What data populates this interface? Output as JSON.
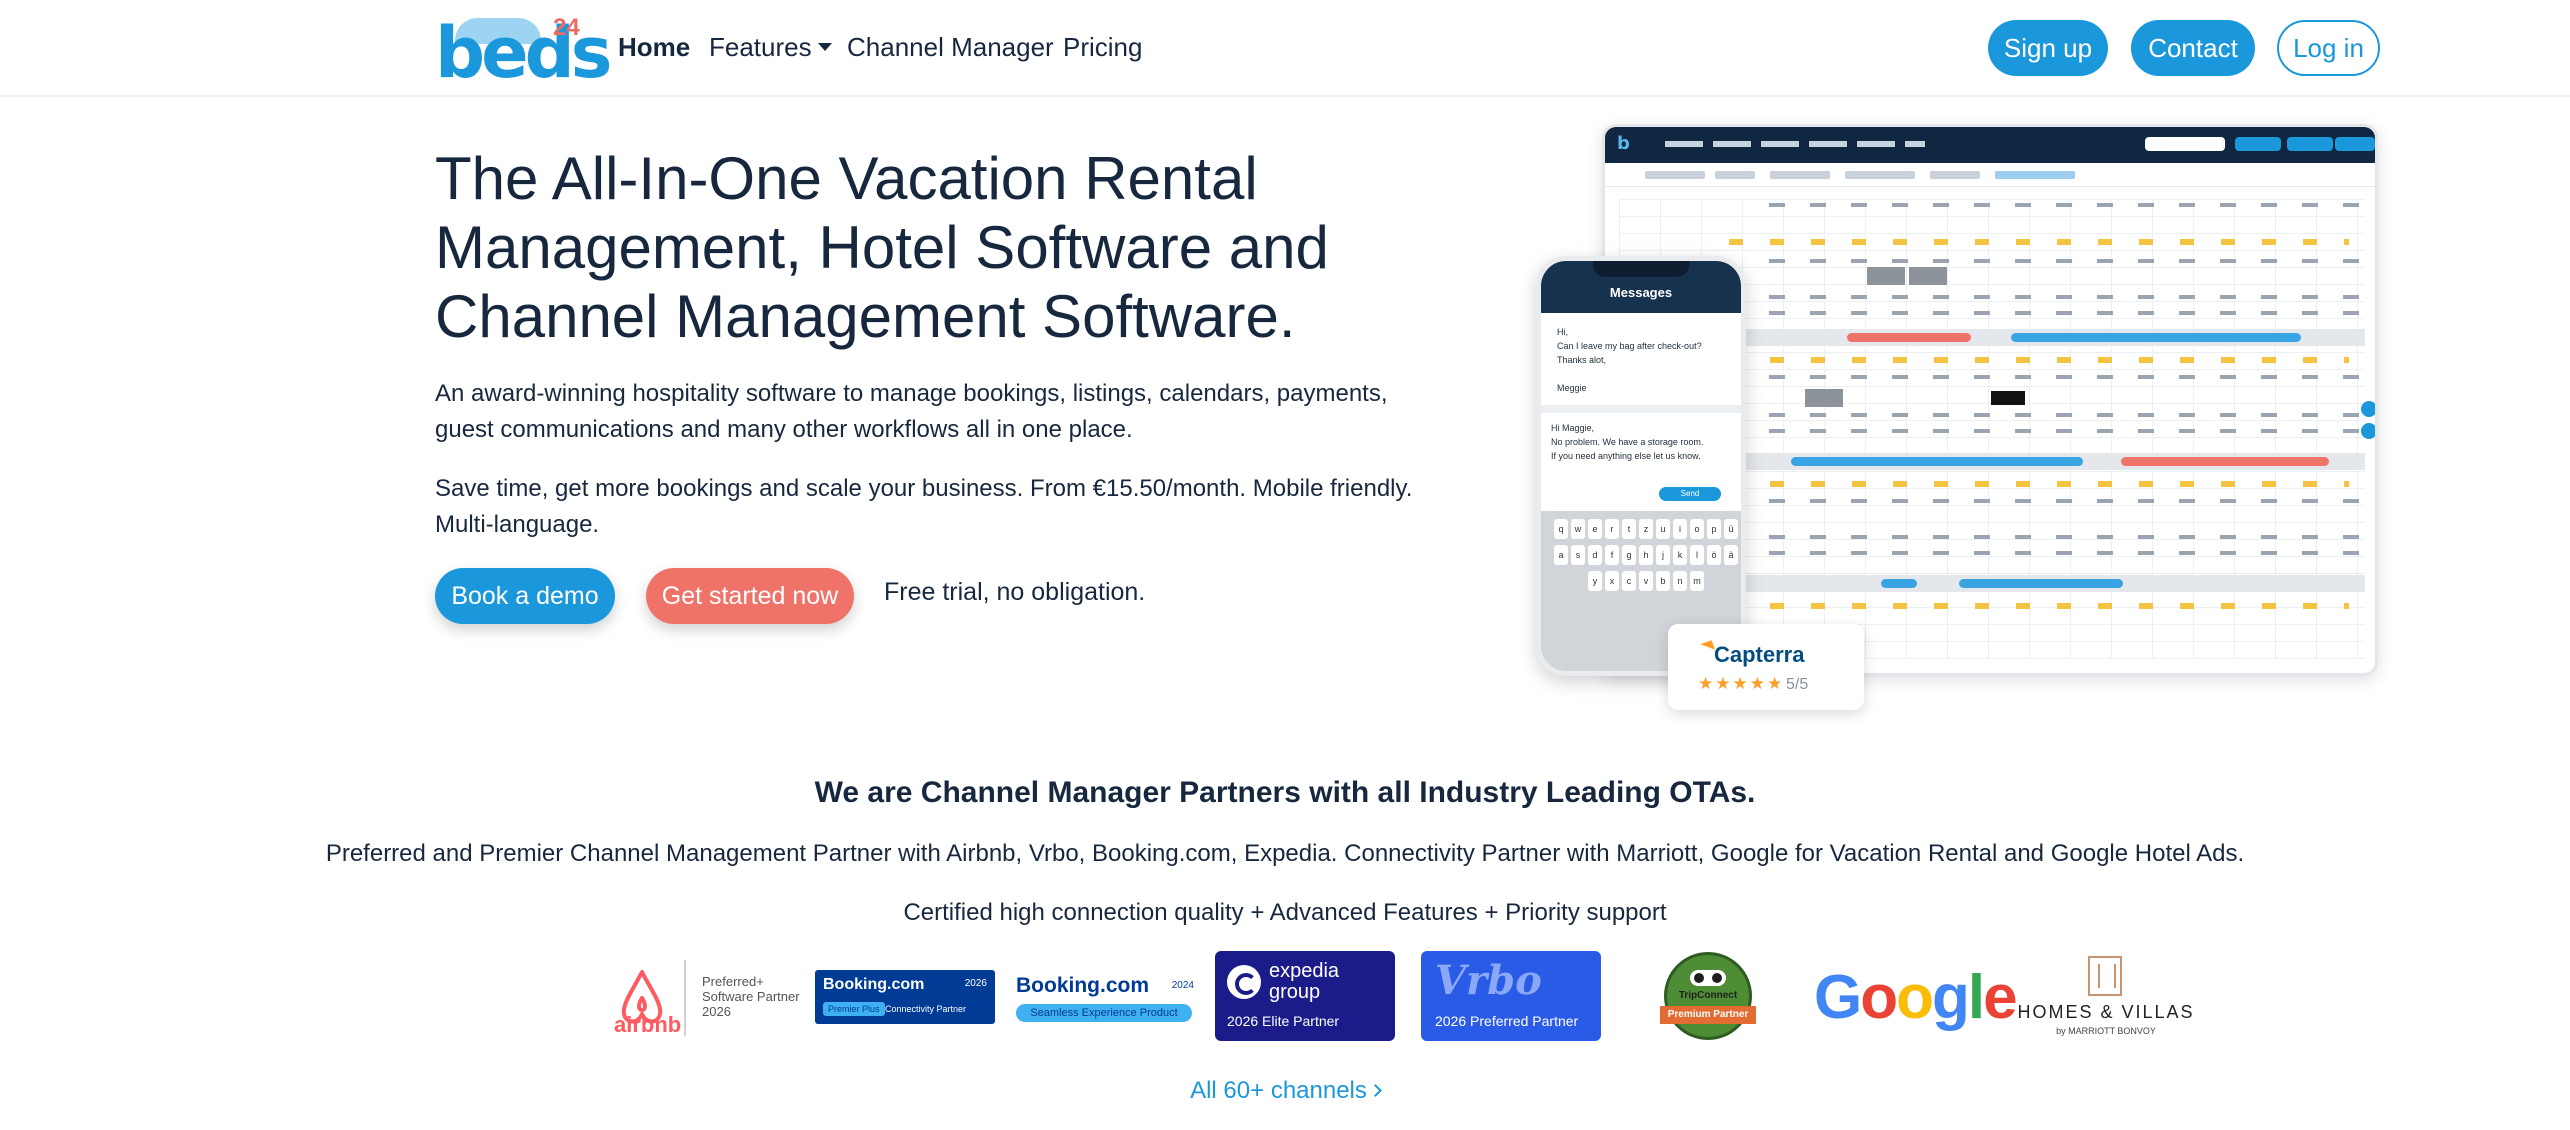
{
  "nav": {
    "logo": "beds",
    "logo_sup": "24",
    "links": [
      "Home",
      "Features",
      "Channel Manager",
      "Pricing"
    ],
    "signup": "Sign up",
    "contact": "Contact",
    "login": "Log in"
  },
  "hero": {
    "title": "The All-In-One Vacation Rental Management, Hotel Software and Channel Management Software.",
    "p1": "An award-winning hospitality software to manage bookings, listings, calendars, payments, guest communications and many other workflows all in one place.",
    "p2": "Save time, get more bookings and scale your business. From €15.50/month. Mobile friendly. Multi-language.",
    "demo_button": "Book a demo",
    "start_button": "Get started now",
    "free_text": "Free trial, no obligation."
  },
  "mockup": {
    "phone_title": "Messages",
    "msg_in": "Hi,\nCan I leave my bag after check-out?\nThanks alot,\n\nMeggie",
    "msg_out": "Hi Maggie,\nNo problem. We have a storage room.\nIf you need anything else let us know.",
    "send": "Send",
    "keyboard_rows": [
      [
        "q",
        "w",
        "e",
        "r",
        "t",
        "z",
        "u",
        "i",
        "o",
        "p",
        "ü"
      ],
      [
        "a",
        "s",
        "d",
        "f",
        "g",
        "h",
        "j",
        "k",
        "l",
        "ö",
        "ä"
      ],
      [
        "y",
        "x",
        "c",
        "v",
        "b",
        "n",
        "m"
      ]
    ],
    "capterra_name": "Capterra",
    "capterra_stars": "★★★★★",
    "capterra_score": "5/5"
  },
  "partners": {
    "heading": "We are Channel Manager Partners with all Industry Leading OTAs.",
    "sub1": "Preferred and Premier Channel Management Partner with Airbnb, Vrbo, Booking.com, Expedia. Connectivity Partner with Marriott, Google for Vacation Rental and Google Hotel Ads.",
    "sub2": "Certified high connection quality + Advanced Features + Priority support",
    "airbnb_word": "airbnb",
    "airbnb_text": "Preferred+\nSoftware Partner\n2026",
    "bk1_word": "Booking.com",
    "bk1_year": "2026",
    "bk1_pill": "Premier Plus",
    "bk1_text": "Connectivity Partner",
    "bk2_word": "Booking.com",
    "bk2_year": "2024",
    "bk2_pill": "Seamless Experience Product",
    "exp_word": "expedia\ngroup",
    "exp_badge": "2026 Elite Partner",
    "vrbo_word": "Vrbo",
    "vrbo_badge": "2026 Preferred Partner",
    "ta_word": "TripConnect",
    "ta_ribbon": "Premium Partner",
    "google_letters": [
      {
        "ch": "G",
        "color": "#4285F4"
      },
      {
        "ch": "o",
        "color": "#EA4335"
      },
      {
        "ch": "o",
        "color": "#FBBC05"
      },
      {
        "ch": "g",
        "color": "#4285F4"
      },
      {
        "ch": "l",
        "color": "#34A853"
      },
      {
        "ch": "e",
        "color": "#EA4335"
      }
    ],
    "hv_word": "HOMES & VILLAS",
    "hv_by": "by MARRIOTT BONVOY",
    "all_channels": "All 60+ channels"
  },
  "colors": {
    "brand_blue": "#1b98db",
    "coral": "#f0736a",
    "text": "#17283e"
  }
}
